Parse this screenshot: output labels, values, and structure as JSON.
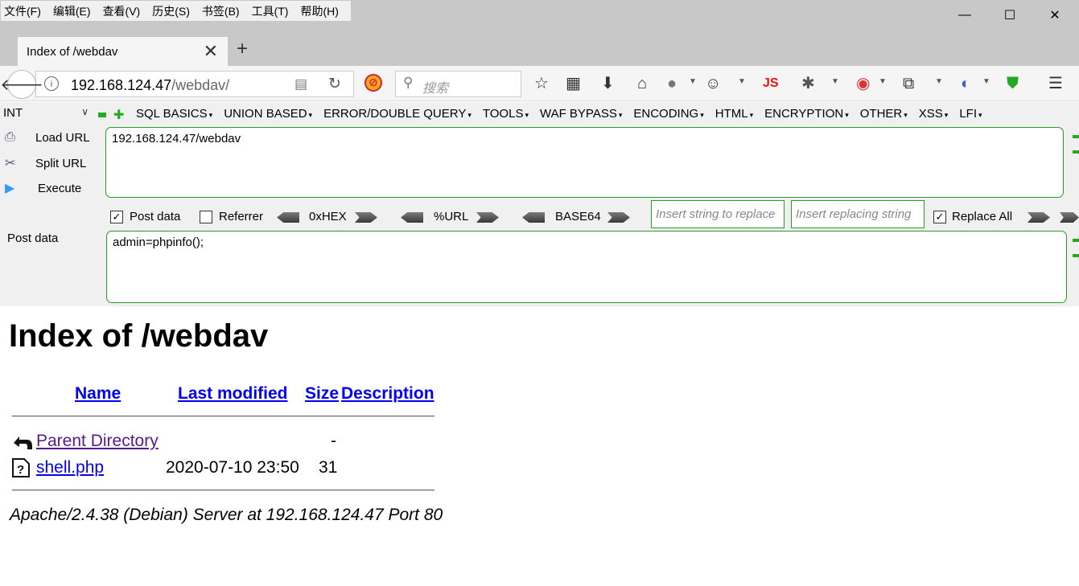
{
  "menu": [
    "文件(F)",
    "编辑(E)",
    "查看(V)",
    "历史(S)",
    "书签(B)",
    "工具(T)",
    "帮助(H)"
  ],
  "window": {
    "minimize": "—",
    "maximize": "☐",
    "close": "✕"
  },
  "tab": {
    "title": "Index of /webdav",
    "close": "✕",
    "new_tab": "+"
  },
  "nav": {
    "back": "🡐",
    "url_host": "192.168.124.47",
    "url_path": "/webdav/",
    "search_placeholder": "搜索",
    "js_label": "JS"
  },
  "hackbar": {
    "type_select": "INT",
    "menus": [
      "SQL BASICS",
      "UNION BASED",
      "ERROR/DOUBLE QUERY",
      "TOOLS",
      "WAF BYPASS",
      "ENCODING",
      "HTML",
      "ENCRYPTION",
      "OTHER",
      "XSS",
      "LFI"
    ],
    "load_url": "Load URL",
    "split_url": "Split URL",
    "execute": "Execute",
    "url_value": "192.168.124.47/webdav",
    "post_data_checked": true,
    "post_data_label": "Post data",
    "referrer_checked": false,
    "referrer_label": "Referrer",
    "hex_label": "0xHEX",
    "url_enc_label": "%URL",
    "base64_label": "BASE64",
    "replace_placeholder": "Insert string to replace",
    "replacing_placeholder": "Insert replacing string",
    "replace_all_checked": true,
    "replace_all_label": "Replace All",
    "post_label": "Post data",
    "post_value": "admin=phpinfo();"
  },
  "page": {
    "title": "Index of /webdav",
    "columns": {
      "name": "Name",
      "last_modified": "Last modified",
      "size": "Size",
      "description": "Description"
    },
    "rows": [
      {
        "name": "Parent Directory",
        "modified": "",
        "size": "-",
        "icon": "back-folder-icon"
      },
      {
        "name": "shell.php",
        "modified": "2020-07-10 23:50",
        "size": "31",
        "icon": "unknown-file-icon"
      }
    ],
    "address": "Apache/2.4.38 (Debian) Server at 192.168.124.47 Port 80"
  },
  "colors": {
    "link": "#0000ee",
    "visited": "#551a8b",
    "hackbar_border": "#2a9a2a"
  }
}
